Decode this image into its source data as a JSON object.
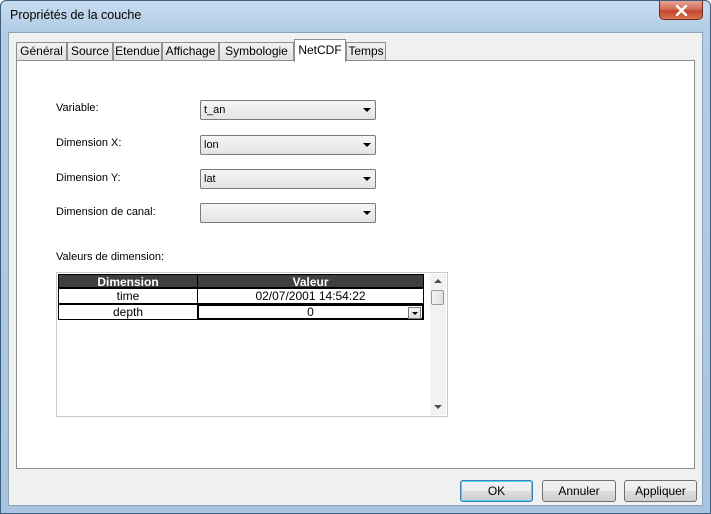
{
  "window": {
    "title": "Propriétés de la couche"
  },
  "tabs": [
    {
      "label": "Général"
    },
    {
      "label": "Source"
    },
    {
      "label": "Etendue"
    },
    {
      "label": "Affichage"
    },
    {
      "label": "Symbologie"
    },
    {
      "label": "NetCDF",
      "active": true
    },
    {
      "label": "Temps"
    }
  ],
  "netcdf": {
    "variable_label": "Variable:",
    "variable_value": "t_an",
    "dimx_label": "Dimension X:",
    "dimx_value": "lon",
    "dimy_label": "Dimension Y:",
    "dimy_value": "lat",
    "band_label": "Dimension de canal:",
    "band_value": "",
    "values_label": "Valeurs de dimension:",
    "grid": {
      "headers": [
        "Dimension",
        "Valeur"
      ],
      "rows": [
        {
          "dimension": "time",
          "value": "02/07/2001 14:54:22"
        },
        {
          "dimension": "depth",
          "value": "0"
        }
      ]
    }
  },
  "buttons": {
    "ok": "OK",
    "cancel": "Annuler",
    "apply": "Appliquer"
  },
  "colors": {
    "accent": "#3c7fb1",
    "grid_header": "#3f3f3f",
    "close": "#c4452d"
  }
}
